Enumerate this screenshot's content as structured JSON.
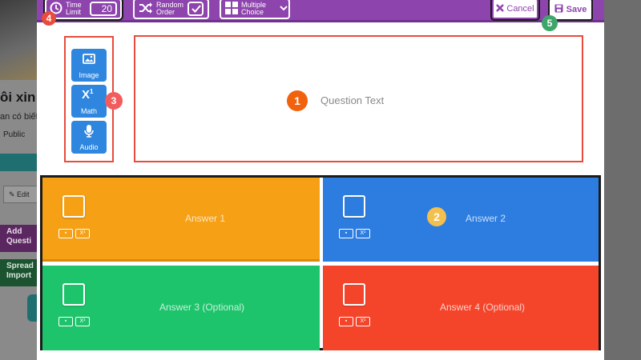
{
  "background": {
    "title_fragment": "ôi xin",
    "subtitle_fragment": "an có biết",
    "visibility": "Public",
    "edit_label": "Edit",
    "add_question_label": "Add Questi",
    "spreadsheet_label": "Spread Import"
  },
  "toolbar": {
    "time_limit_label": "Time Limit",
    "time_limit_value": "20",
    "random_order_label": "Random Order",
    "question_type_label": "Multiple Choice",
    "cancel_label": "Cancel",
    "save_label": "Save"
  },
  "media": {
    "image_label": "Image",
    "math_label": "Math",
    "audio_label": "Audio"
  },
  "question": {
    "placeholder": "Question Text"
  },
  "answers": [
    {
      "placeholder": "Answer 1",
      "color": "#f5a015"
    },
    {
      "placeholder": "Answer 2",
      "color": "#2d7de0"
    },
    {
      "placeholder": "Answer 3 (Optional)",
      "color": "#1ec46b"
    },
    {
      "placeholder": "Answer 4 (Optional)",
      "color": "#f4452b"
    }
  ],
  "badges": {
    "question_text": "1",
    "answers": "2",
    "media": "3",
    "time_limit": "4",
    "save": "5"
  },
  "colors": {
    "toolbar": "#8e44ad",
    "highlight_border": "#e74c3c",
    "media_button": "#2e86de"
  }
}
